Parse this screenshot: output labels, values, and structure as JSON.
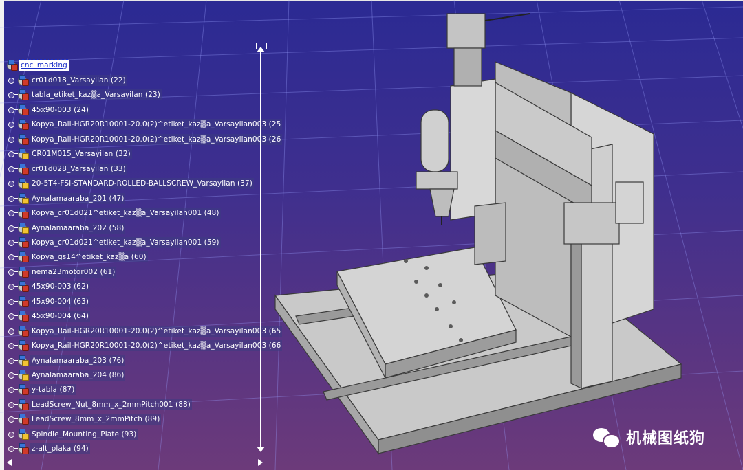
{
  "tree": {
    "root_label": "cnc_marking",
    "items": [
      {
        "label": "cr01d018_Varsayilan (22)",
        "icon": "part-icon"
      },
      {
        "label": "tabla_etiket_kaz▒a_Varsayilan (23)",
        "icon": "part-icon"
      },
      {
        "label": "45x90-003 (24)",
        "icon": "part-icon"
      },
      {
        "label": "Kopya_Rail-HGR20R10001-20.0(2)^etiket_kaz▒a_Varsayilan003 (25",
        "icon": "part-icon"
      },
      {
        "label": "Kopya_Rail-HGR20R10001-20.0(2)^etiket_kaz▒a_Varsayilan003 (26",
        "icon": "part-icon"
      },
      {
        "label": "CR01M015_Varsayilan (32)",
        "icon": "assembly-icon"
      },
      {
        "label": "cr01d028_Varsayilan (33)",
        "icon": "part-icon"
      },
      {
        "label": "20-5T4-FSI-STANDARD-ROLLED-BALLSCREW_Varsayilan (37)",
        "icon": "assembly-icon"
      },
      {
        "label": "Aynalamaaraba_201 (47)",
        "icon": "assembly-icon"
      },
      {
        "label": "Kopya_cr01d021^etiket_kaz▒a_Varsayilan001 (48)",
        "icon": "part-icon"
      },
      {
        "label": "Aynalamaaraba_202 (58)",
        "icon": "assembly-icon"
      },
      {
        "label": "Kopya_cr01d021^etiket_kaz▒a_Varsayilan001 (59)",
        "icon": "part-icon"
      },
      {
        "label": "Kopya_gs14^etiket_kaz▒a (60)",
        "icon": "part-icon"
      },
      {
        "label": "nema23motor002 (61)",
        "icon": "part-icon"
      },
      {
        "label": "45x90-003 (62)",
        "icon": "part-icon"
      },
      {
        "label": "45x90-004 (63)",
        "icon": "part-icon"
      },
      {
        "label": "45x90-004 (64)",
        "icon": "part-icon"
      },
      {
        "label": "Kopya_Rail-HGR20R10001-20.0(2)^etiket_kaz▒a_Varsayilan003 (65",
        "icon": "part-icon"
      },
      {
        "label": "Kopya_Rail-HGR20R10001-20.0(2)^etiket_kaz▒a_Varsayilan003 (66",
        "icon": "part-icon"
      },
      {
        "label": "Aynalamaaraba_203 (76)",
        "icon": "assembly-icon"
      },
      {
        "label": "Aynalamaaraba_204 (86)",
        "icon": "assembly-icon"
      },
      {
        "label": "y-tabla (87)",
        "icon": "part-icon"
      },
      {
        "label": "LeadScrew_Nut_8mm_x_2mmPitch001 (88)",
        "icon": "part-icon"
      },
      {
        "label": "LeadScrew_8mm_x_2mmPitch (89)",
        "icon": "part-icon"
      },
      {
        "label": "Spindle_Mounting_Plate (93)",
        "icon": "assembly-icon"
      },
      {
        "label": "z-alt_plaka (94)",
        "icon": "part-icon"
      }
    ]
  },
  "watermark": {
    "text": "机械图纸狗",
    "icon": "wechat-icon"
  },
  "colors": {
    "background_top": "#2b2a93",
    "background_bottom": "#6c3a7a",
    "model_gray": "#c8c8c8",
    "grid_line": "#9aa0ff"
  }
}
